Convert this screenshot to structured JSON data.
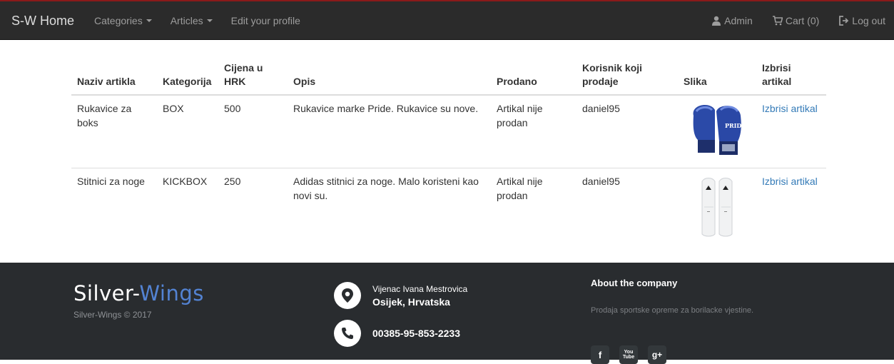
{
  "navbar": {
    "brand": "S-W Home",
    "categories": "Categories",
    "articles": "Articles",
    "edit_profile": "Edit your profile",
    "admin": "Admin",
    "cart": "Cart (0)",
    "logout": "Log out"
  },
  "table": {
    "headers": {
      "name": "Naziv artikla",
      "category": "Kategorija",
      "price": "Cijena u HRK",
      "description": "Opis",
      "sold": "Prodano",
      "seller": "Korisnik koji prodaje",
      "image": "Slika",
      "delete": "Izbrisi artikal"
    },
    "rows": [
      {
        "name": "Rukavice za boks",
        "category": "BOX",
        "price": "500",
        "description": "Rukavice marke Pride. Rukavice su nove.",
        "sold": "Artikal nije prodan",
        "seller": "daniel95",
        "image_icon": "boxing-gloves-image",
        "image_text": "PRIDE",
        "delete": "Izbrisi artikal"
      },
      {
        "name": "Stitnici za noge",
        "category": "KICKBOX",
        "price": "250",
        "description": "Adidas stitnici za noge. Malo koristeni kao novi su.",
        "sold": "Artikal nije prodan",
        "seller": "daniel95",
        "image_icon": "shin-guards-image",
        "delete": "Izbrisi artikal"
      }
    ]
  },
  "footer": {
    "logo_part1": "Silver-",
    "logo_part2": "Wings",
    "copyright": "Silver-Wings © 2017",
    "address_line1": "Vijenac Ivana Mestrovica",
    "address_line2": "Osijek, Hrvatska",
    "phone": "00385-95-853-2233",
    "about_title": "About the company",
    "about_text": "Prodaja sportske opreme za borilacke vjestine.",
    "social": [
      "f",
      "You Tube",
      "g+"
    ]
  },
  "colors": {
    "navbar_bg": "#2b2b2b",
    "footer_bg": "#292c2f",
    "link": "#337ab7",
    "logo_accent": "#5383d3"
  }
}
